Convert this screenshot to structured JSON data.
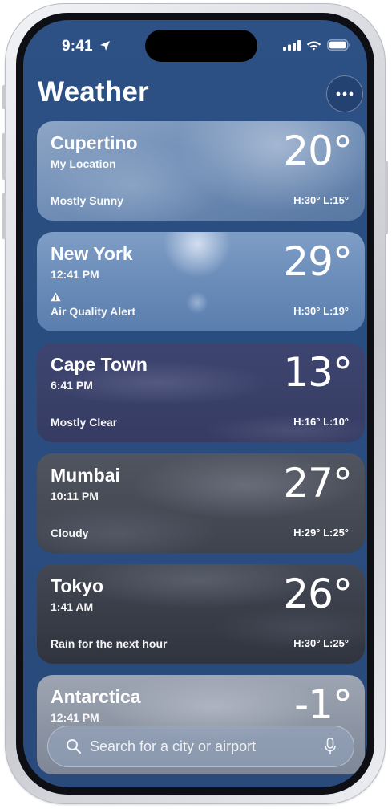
{
  "status_bar": {
    "time": "9:41",
    "icons": [
      "location-arrow-icon",
      "cellular-signal-icon",
      "wifi-icon",
      "battery-icon"
    ]
  },
  "header": {
    "title": "Weather",
    "more_button_icon": "ellipsis-icon"
  },
  "locations": [
    {
      "city": "Cupertino",
      "subtitle": "My Location",
      "condition": "Mostly Sunny",
      "temperature": "20°",
      "high_low": "H:30°  L:15°",
      "background": "sunny-sky"
    },
    {
      "city": "New York",
      "subtitle": "12:41 PM",
      "alert_icon": "warning-triangle-icon",
      "condition": "Air Quality Alert",
      "temperature": "29°",
      "high_low": "H:30°  L:19°",
      "background": "hazy-sun"
    },
    {
      "city": "Cape Town",
      "subtitle": "6:41 PM",
      "condition": "Mostly Clear",
      "temperature": "13°",
      "high_low": "H:16°  L:10°",
      "background": "night-clouds"
    },
    {
      "city": "Mumbai",
      "subtitle": "10:11 PM",
      "condition": "Cloudy",
      "temperature": "27°",
      "high_low": "H:29°  L:25°",
      "background": "night-cloudy"
    },
    {
      "city": "Tokyo",
      "subtitle": "1:41 AM",
      "condition": "Rain for the next hour",
      "temperature": "26°",
      "high_low": "H:30°  L:25°",
      "background": "night-rain"
    },
    {
      "city": "Antarctica",
      "subtitle": "12:41 PM",
      "temperature": "-1°",
      "background": "overcast"
    }
  ],
  "search": {
    "placeholder": "Search for a city or airport",
    "value": "",
    "icon": "magnifying-glass-icon",
    "mic_icon": "microphone-icon"
  },
  "colors": {
    "background": "#2a4d80",
    "text": "#ffffff"
  }
}
